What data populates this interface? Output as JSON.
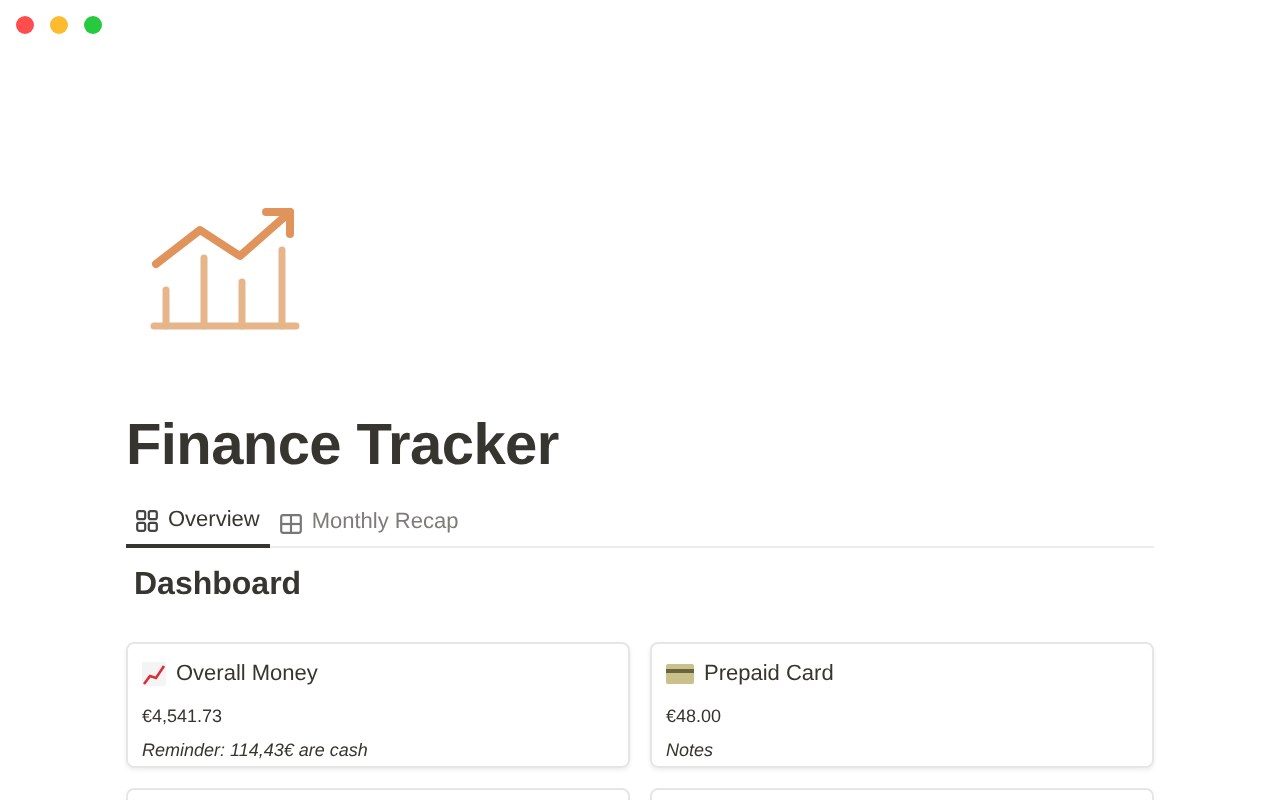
{
  "page": {
    "title": "Finance Tracker"
  },
  "tabs": [
    {
      "label": "Overview",
      "kind": "gallery",
      "selected": true
    },
    {
      "label": "Monthly Recap",
      "kind": "table",
      "selected": false
    }
  ],
  "section": {
    "heading": "Dashboard"
  },
  "cards": [
    {
      "kind": "chart",
      "title": "Overall Money",
      "amount": "€4,541.73",
      "note": "Reminder: 114,43€ are cash"
    },
    {
      "kind": "card",
      "title": "Prepaid Card",
      "amount": "€48.00",
      "note": "Notes"
    }
  ]
}
